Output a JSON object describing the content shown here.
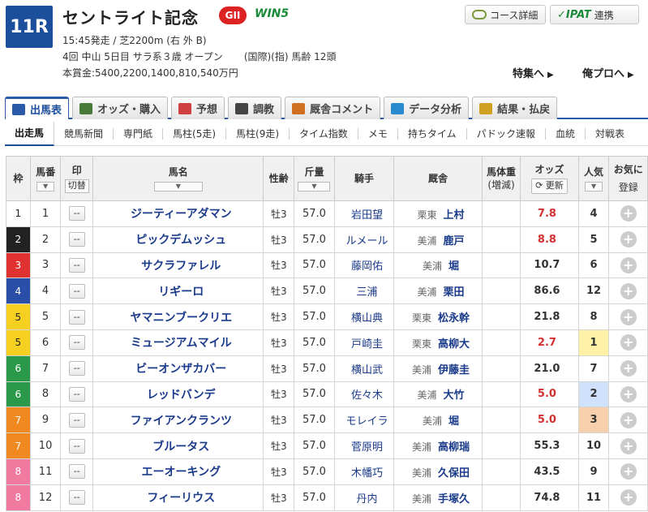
{
  "race": {
    "number": "11R",
    "name": "セントライト記念",
    "grade": "GII",
    "win5": "WIN5",
    "line1": "15:45発走 / 芝2200m (右 外 B)",
    "line2": "4回 中山 5日目 サラ系３歳 オープン",
    "line2b": "(国際)(指) 馬齢 12頭",
    "line3": "本賞金:5400,2200,1400,810,540万円"
  },
  "buttons": {
    "course": "コース詳細",
    "ipat_logo": "IPAT",
    "ipat": "連携"
  },
  "links": {
    "tokushu": "特集へ",
    "orepro": "俺プロへ"
  },
  "tabs": [
    {
      "label": "出馬表",
      "color": "#2a5aa8"
    },
    {
      "label": "オッズ・購入",
      "color": "#4a7a3a"
    },
    {
      "label": "予想",
      "color": "#d04040"
    },
    {
      "label": "調教",
      "color": "#444444"
    },
    {
      "label": "厩舎コメント",
      "color": "#d07020"
    },
    {
      "label": "データ分析",
      "color": "#2a8ad0"
    },
    {
      "label": "結果・払戻",
      "color": "#d0a020"
    }
  ],
  "subnav": [
    "出走馬",
    "競馬新聞",
    "専門紙",
    "馬柱(5走)",
    "馬柱(9走)",
    "タイム指数",
    "メモ",
    "持ちタイム",
    "パドック速報",
    "血統",
    "対戦表"
  ],
  "table": {
    "headers": {
      "waku": "枠",
      "umaban": "馬番",
      "mark": "印",
      "mark_toggle": "切替",
      "name": "馬名",
      "sex": "性齢",
      "kinryo": "斤量",
      "jockey": "騎手",
      "stable": "厩舎",
      "bodyweight": "馬体重",
      "bodyweight_sub": "(増減)",
      "odds": "オッズ",
      "refresh": "更新",
      "popularity": "人気",
      "fav": "お気に",
      "fav_sub": "登録"
    },
    "rows": [
      {
        "waku": "1",
        "waku_bg": "#ffffff",
        "waku_fg": "#222222",
        "umaban": "1",
        "mark": "--",
        "name": "ジーティーアダマン",
        "sex": "牡3",
        "weight": "57.0",
        "jockey": "岩田望",
        "region": "栗東",
        "trainer": "上村",
        "odds": "7.8",
        "hot": true,
        "pop": "4",
        "pop_class": ""
      },
      {
        "waku": "2",
        "waku_bg": "#222222",
        "waku_fg": "#ffffff",
        "umaban": "2",
        "mark": "--",
        "name": "ピックデムッシュ",
        "sex": "牡3",
        "weight": "57.0",
        "jockey": "ルメール",
        "region": "美浦",
        "trainer": "鹿戸",
        "odds": "8.8",
        "hot": true,
        "pop": "5",
        "pop_class": ""
      },
      {
        "waku": "3",
        "waku_bg": "#e03030",
        "waku_fg": "#ffffff",
        "umaban": "3",
        "mark": "--",
        "name": "サクラファレル",
        "sex": "牡3",
        "weight": "57.0",
        "jockey": "藤岡佑",
        "region": "美浦",
        "trainer": "堀",
        "odds": "10.7",
        "hot": false,
        "pop": "6",
        "pop_class": ""
      },
      {
        "waku": "4",
        "waku_bg": "#2a4fa8",
        "waku_fg": "#ffffff",
        "umaban": "4",
        "mark": "--",
        "name": "リギーロ",
        "sex": "牡3",
        "weight": "57.0",
        "jockey": "三浦",
        "region": "美浦",
        "trainer": "栗田",
        "odds": "86.6",
        "hot": false,
        "pop": "12",
        "pop_class": ""
      },
      {
        "waku": "5",
        "waku_bg": "#f5d020",
        "waku_fg": "#222222",
        "umaban": "5",
        "mark": "--",
        "name": "ヤマニンブークリエ",
        "sex": "牡3",
        "weight": "57.0",
        "jockey": "横山典",
        "region": "栗東",
        "trainer": "松永幹",
        "odds": "21.8",
        "hot": false,
        "pop": "8",
        "pop_class": ""
      },
      {
        "waku": "5",
        "waku_bg": "#f5d020",
        "waku_fg": "#222222",
        "umaban": "6",
        "mark": "--",
        "name": "ミュージアムマイル",
        "sex": "牡3",
        "weight": "57.0",
        "jockey": "戸崎圭",
        "region": "栗東",
        "trainer": "高柳大",
        "odds": "2.7",
        "hot": true,
        "pop": "1",
        "pop_class": "p1"
      },
      {
        "waku": "6",
        "waku_bg": "#2a9a4a",
        "waku_fg": "#ffffff",
        "umaban": "7",
        "mark": "--",
        "name": "ビーオンザカバー",
        "sex": "牡3",
        "weight": "57.0",
        "jockey": "横山武",
        "region": "美浦",
        "trainer": "伊藤圭",
        "odds": "21.0",
        "hot": false,
        "pop": "7",
        "pop_class": ""
      },
      {
        "waku": "6",
        "waku_bg": "#2a9a4a",
        "waku_fg": "#ffffff",
        "umaban": "8",
        "mark": "--",
        "name": "レッドバンデ",
        "sex": "牡3",
        "weight": "57.0",
        "jockey": "佐々木",
        "region": "美浦",
        "trainer": "大竹",
        "odds": "5.0",
        "hot": true,
        "pop": "2",
        "pop_class": "p2"
      },
      {
        "waku": "7",
        "waku_bg": "#f08a20",
        "waku_fg": "#ffffff",
        "umaban": "9",
        "mark": "--",
        "name": "ファイアンクランツ",
        "sex": "牡3",
        "weight": "57.0",
        "jockey": "モレイラ",
        "region": "美浦",
        "trainer": "堀",
        "odds": "5.0",
        "hot": true,
        "pop": "3",
        "pop_class": "p3"
      },
      {
        "waku": "7",
        "waku_bg": "#f08a20",
        "waku_fg": "#ffffff",
        "umaban": "10",
        "mark": "--",
        "name": "ブルータス",
        "sex": "牡3",
        "weight": "57.0",
        "jockey": "菅原明",
        "region": "美浦",
        "trainer": "高柳瑞",
        "odds": "55.3",
        "hot": false,
        "pop": "10",
        "pop_class": ""
      },
      {
        "waku": "8",
        "waku_bg": "#f07aa0",
        "waku_fg": "#ffffff",
        "umaban": "11",
        "mark": "--",
        "name": "エーオーキング",
        "sex": "牡3",
        "weight": "57.0",
        "jockey": "木幡巧",
        "region": "美浦",
        "trainer": "久保田",
        "odds": "43.5",
        "hot": false,
        "pop": "9",
        "pop_class": ""
      },
      {
        "waku": "8",
        "waku_bg": "#f07aa0",
        "waku_fg": "#ffffff",
        "umaban": "12",
        "mark": "--",
        "name": "フィーリウス",
        "sex": "牡3",
        "weight": "57.0",
        "jockey": "丹内",
        "region": "美浦",
        "trainer": "手塚久",
        "odds": "74.8",
        "hot": false,
        "pop": "11",
        "pop_class": ""
      }
    ]
  }
}
